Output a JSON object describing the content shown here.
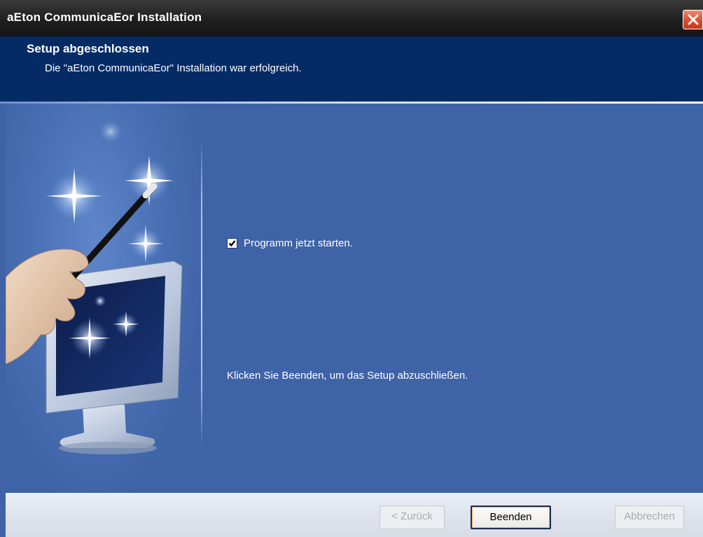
{
  "window": {
    "title": "aEton CommunicaEor Installation"
  },
  "header": {
    "title": "Setup abgeschlossen",
    "subtitle": "Die \"aEton CommunicaEor\" Installation war erfolgreich."
  },
  "main": {
    "checkbox": {
      "label": "Programm jetzt starten.",
      "checked": true
    },
    "instruction": "Klicken Sie Beenden, um das Setup abzuschließen."
  },
  "buttons": {
    "back": "< Zurück",
    "finish": "Beenden",
    "cancel": "Abbrechen"
  },
  "colors": {
    "header_bg": "#052b65",
    "content_bg": "#3f63a7",
    "close_red": "#d9482a"
  },
  "icons": {
    "close": "close-icon",
    "checkmark": "checkmark-icon",
    "illustration": "wand-monitor-illustration"
  }
}
